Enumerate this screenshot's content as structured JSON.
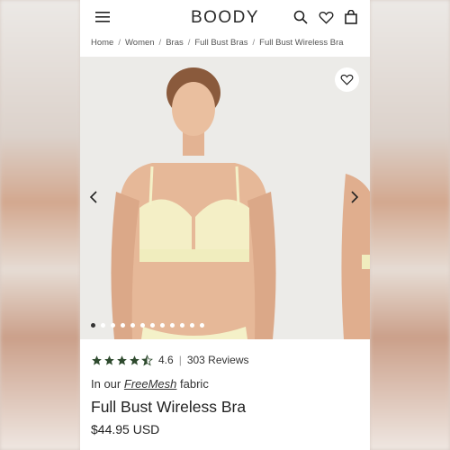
{
  "header": {
    "logo": "BOODY",
    "menu_icon": "hamburger-menu-icon",
    "search_icon": "search-icon",
    "wishlist_icon": "heart-icon",
    "cart_icon": "shopping-bag-icon"
  },
  "breadcrumb": [
    "Home",
    "Women",
    "Bras",
    "Full Bust Bras",
    "Full Bust Wireless Bra"
  ],
  "gallery": {
    "dots_total": 12,
    "active_index": 0
  },
  "product": {
    "rating": "4.6",
    "reviews": "303 Reviews",
    "fabric_prefix": "In our",
    "fabric_name": "FreeMesh",
    "fabric_suffix": "fabric",
    "name": "Full Bust Wireless Bra",
    "price": "$44.95 USD"
  },
  "colors": {
    "star": "#2e4a2e",
    "text": "#222222"
  }
}
